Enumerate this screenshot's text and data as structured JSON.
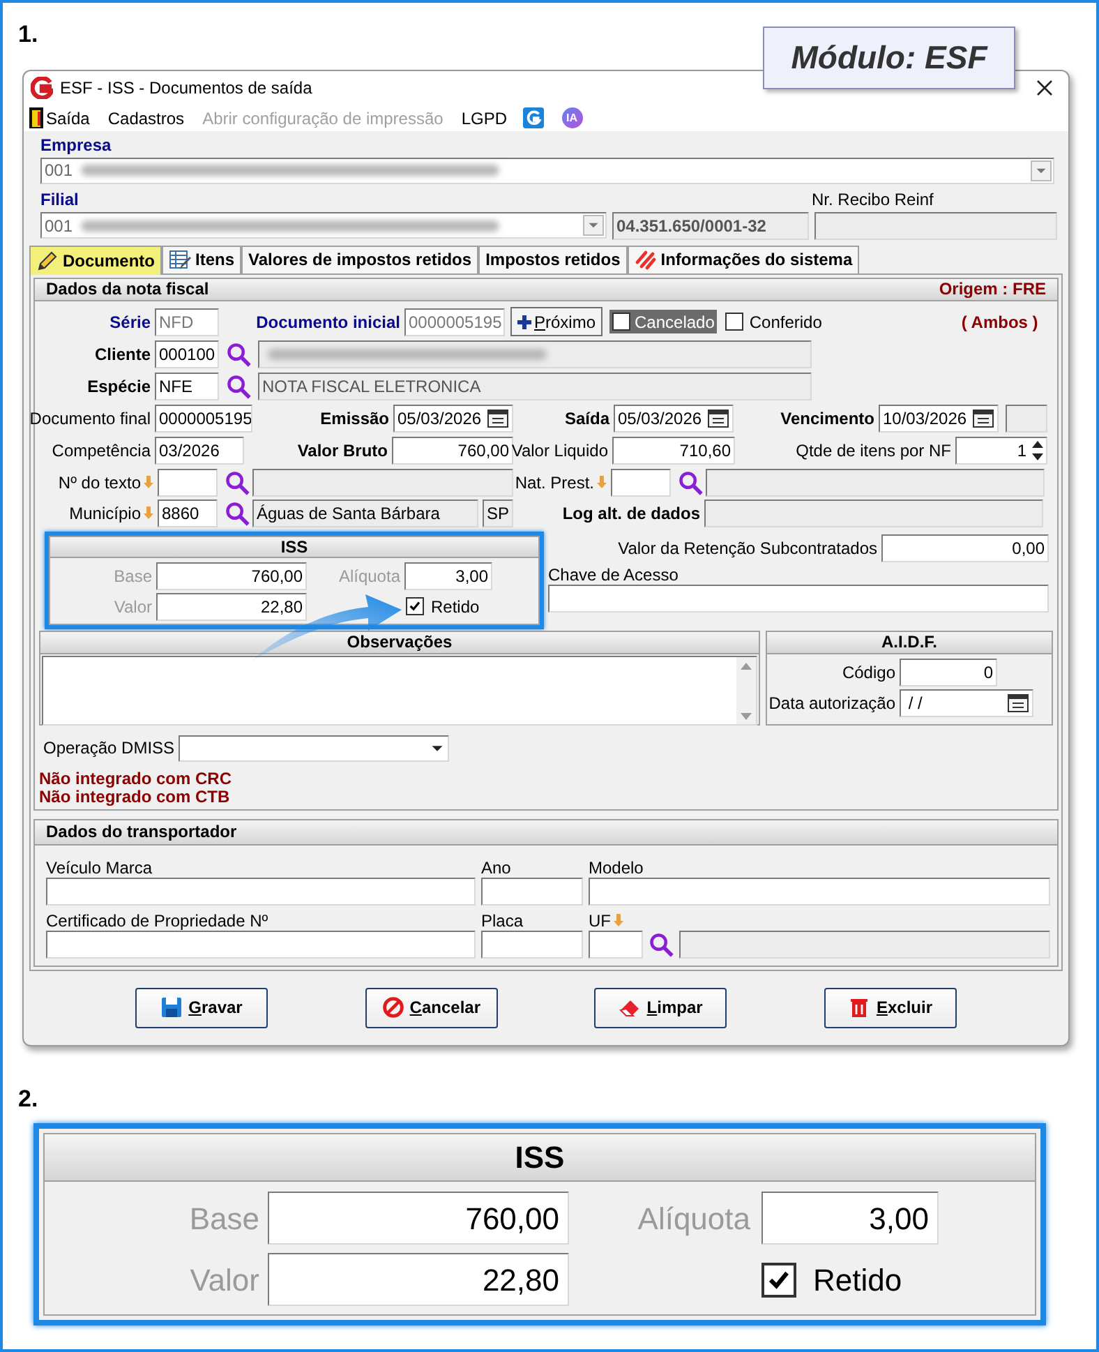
{
  "steps": [
    "1.",
    "2."
  ],
  "module_badge": "Módulo: ESF",
  "window": {
    "title": "ESF - ISS - Documentos de saída"
  },
  "menu": [
    {
      "label": "Saída",
      "disabled": false
    },
    {
      "label": "Cadastros",
      "disabled": false
    },
    {
      "label": "Abrir configuração de impressão",
      "disabled": true
    },
    {
      "label": "LGPD",
      "disabled": false
    },
    {
      "label": "IA",
      "disabled": false
    }
  ],
  "empresa": {
    "label": "Empresa",
    "value": "001"
  },
  "filial": {
    "label": "Filial",
    "value": "001",
    "cnpj": "04.351.650/0001-32"
  },
  "recibo_reinf": {
    "label": "Nr. Recibo Reinf"
  },
  "tabs": [
    {
      "label": "Documento",
      "selected": true
    },
    {
      "label": "Itens",
      "selected": false
    },
    {
      "label": "Valores de impostos retidos",
      "selected": false
    },
    {
      "label": "Impostos retidos",
      "selected": false
    },
    {
      "label": "Informações do sistema",
      "selected": false
    }
  ],
  "nota_fiscal": {
    "title": "Dados da nota fiscal",
    "origem": "Origem : FRE",
    "ambos": "( Ambos )",
    "serie": {
      "label": "Série",
      "value": "NFD",
      "disabled": true
    },
    "documento_inicial": {
      "label": "Documento inicial",
      "value": "0000005195",
      "disabled": true
    },
    "proximo_button": "Próximo",
    "cancelado": {
      "label": "Cancelado",
      "checked": false
    },
    "conferido": {
      "label": "Conferido",
      "checked": false
    },
    "cliente": {
      "label": "Cliente",
      "value": "000100"
    },
    "especie": {
      "label": "Espécie",
      "value": "NFE",
      "description": "NOTA FISCAL ELETRONICA"
    },
    "documento_final": {
      "label": "Documento final",
      "value": "0000005195"
    },
    "emissao": {
      "label": "Emissão",
      "value": "05/03/2026"
    },
    "saida": {
      "label": "Saída",
      "value": "05/03/2026"
    },
    "vencimento": {
      "label": "Vencimento",
      "value": "10/03/2026"
    },
    "competencia": {
      "label": "Competência",
      "value": "03/2026"
    },
    "valor_bruto": {
      "label": "Valor Bruto",
      "value": "760,00"
    },
    "valor_liquido": {
      "label": "Valor Liquido",
      "value": "710,60"
    },
    "qtde_itens": {
      "label": "Qtde de itens por NF",
      "value": "1"
    },
    "nr_texto": {
      "label": "Nº do texto"
    },
    "nat_prest": {
      "label": "Nat. Prest."
    },
    "municipio": {
      "label": "Município",
      "value": "8860",
      "name": "Águas de Santa Bárbara",
      "uf": "SP"
    },
    "log_alt": {
      "label": "Log alt. de dados"
    },
    "iss": {
      "title": "ISS",
      "base_label": "Base",
      "base": "760,00",
      "aliquota_label": "Alíquota",
      "aliquota": "3,00",
      "valor_label": "Valor",
      "valor": "22,80",
      "retido": {
        "label": "Retido",
        "checked": true
      }
    },
    "valor_retencao": {
      "label": "Valor da Retenção Subcontratados",
      "value": "0,00"
    },
    "chave_acesso": {
      "label": "Chave de Acesso"
    },
    "observacoes": {
      "title": "Observações"
    },
    "aidf": {
      "title": "A.I.D.F.",
      "codigo_label": "Código",
      "codigo": "0",
      "data_label": "Data autorização",
      "data": " / /"
    },
    "operacao_dmiss": {
      "label": "Operação DMISS"
    },
    "notices": [
      "Não integrado com CRC",
      "Não integrado com CTB"
    ]
  },
  "transportador": {
    "title": "Dados do transportador",
    "veiculo_marca": "Veículo Marca",
    "ano": "Ano",
    "modelo": "Modelo",
    "certificado": "Certificado de Propriedade Nº",
    "placa": "Placa",
    "uf": "UF"
  },
  "buttons": [
    {
      "label": "Gravar"
    },
    {
      "label": "Cancelar"
    },
    {
      "label": "Limpar"
    },
    {
      "label": "Excluir"
    }
  ],
  "zoom_iss": {
    "title": "ISS",
    "base_label": "Base",
    "base": "760,00",
    "aliquota_label": "Alíquota",
    "aliquota": "3,00",
    "valor_label": "Valor",
    "valor": "22,80",
    "retido": {
      "label": "Retido",
      "checked": true
    }
  }
}
